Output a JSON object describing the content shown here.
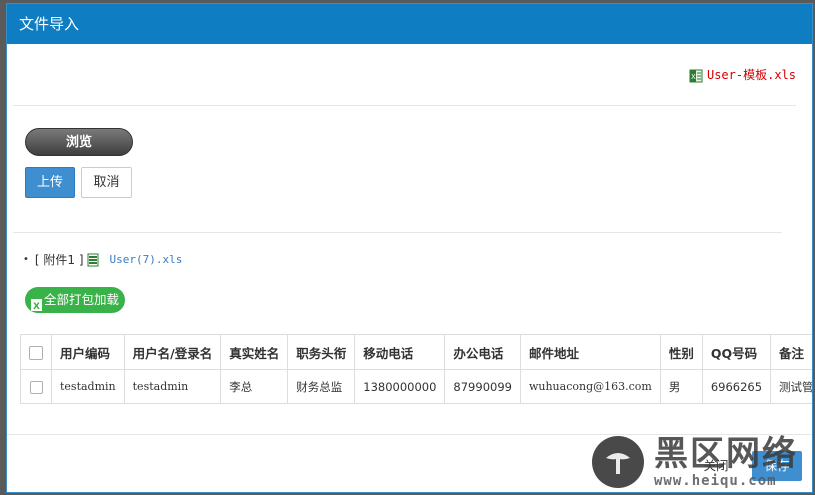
{
  "dialog": {
    "title": "文件导入"
  },
  "template": {
    "link_text": "User-模板.xls"
  },
  "upload": {
    "browse_label": "浏览",
    "upload_label": "上传",
    "cancel_label": "取消"
  },
  "attachment": {
    "bullet": "•",
    "label": "[ 附件1 ]",
    "file_name": "User(7).xls"
  },
  "zip_button": {
    "label": "全部打包加载"
  },
  "table": {
    "columns": [
      "用户编码",
      "用户名/登录名",
      "真实姓名",
      "职务头衔",
      "移动电话",
      "办公电话",
      "邮件地址",
      "性别",
      "QQ号码",
      "备注"
    ],
    "rows": [
      [
        "testadmin",
        "testadmin",
        "李总",
        "财务总监",
        "1380000000",
        "87990099",
        "wuhuacong@163.com",
        "男",
        "6966265",
        "测试管理员"
      ]
    ]
  },
  "footer": {
    "close_label": "关闭",
    "save_label": "保存"
  },
  "watermark": {
    "main": "黑区网络",
    "sub": "www.heiqu.com"
  },
  "colors": {
    "titlebar": "#0f7dc2",
    "primary_button": "#3f8fd0",
    "green_button": "#3ab24a",
    "template_link": "#d40000",
    "attachment_link": "#3a7dbf"
  }
}
